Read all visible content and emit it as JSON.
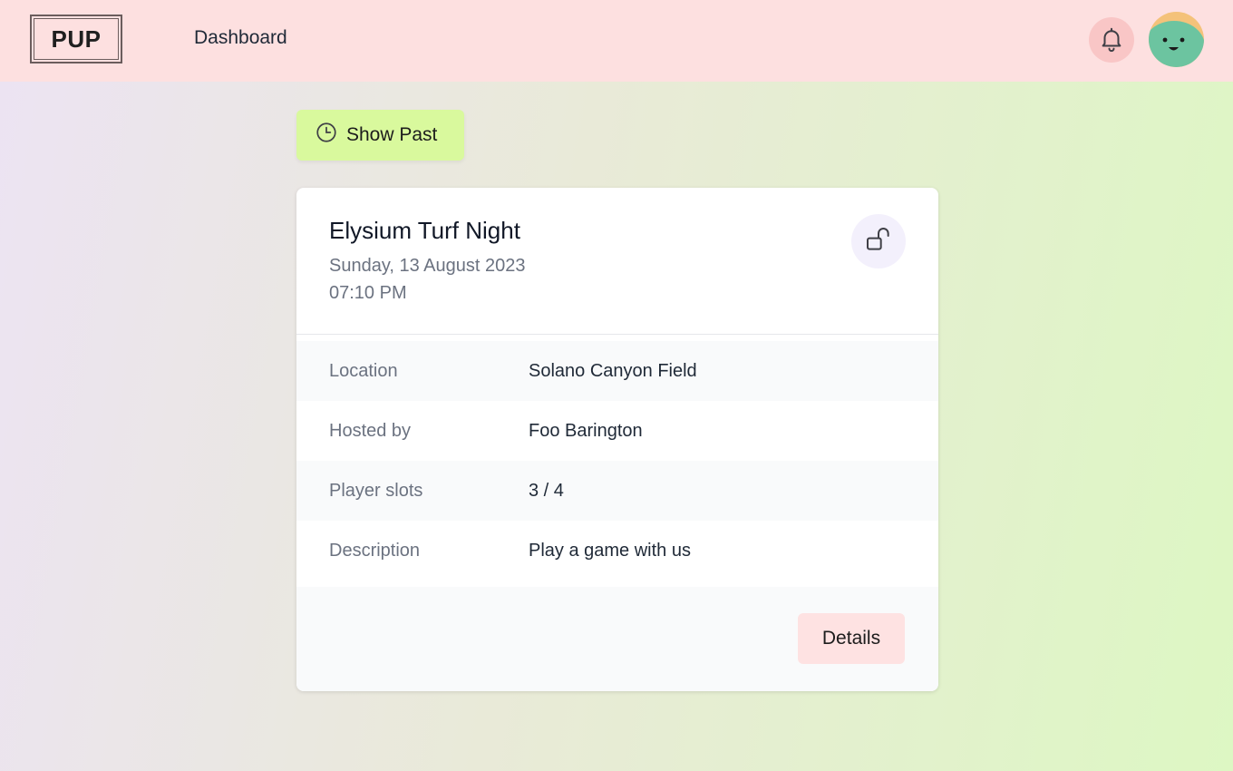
{
  "header": {
    "logo_text": "PUP",
    "nav_link": "Dashboard",
    "icons": {
      "notifications": "bell-icon",
      "avatar": "smiley-avatar"
    },
    "colors": {
      "background": "#fde0e0",
      "bell_bg": "#f9c6c6"
    }
  },
  "toolbar": {
    "show_past_label": "Show Past",
    "show_past_icon": "clock-icon",
    "color": "#d9f99d"
  },
  "event": {
    "title": "Elysium Turf Night",
    "date": "Sunday, 13 August 2023",
    "time": "07:10 PM",
    "lock_icon": "unlock-icon",
    "rows": [
      {
        "label": "Location",
        "value": "Solano Canyon Field"
      },
      {
        "label": "Hosted by",
        "value": "Foo Barington"
      },
      {
        "label": "Player slots",
        "value": "3 / 4"
      },
      {
        "label": "Description",
        "value": "Play a game with us"
      }
    ],
    "details_label": "Details",
    "details_color": "#fee2e2"
  }
}
